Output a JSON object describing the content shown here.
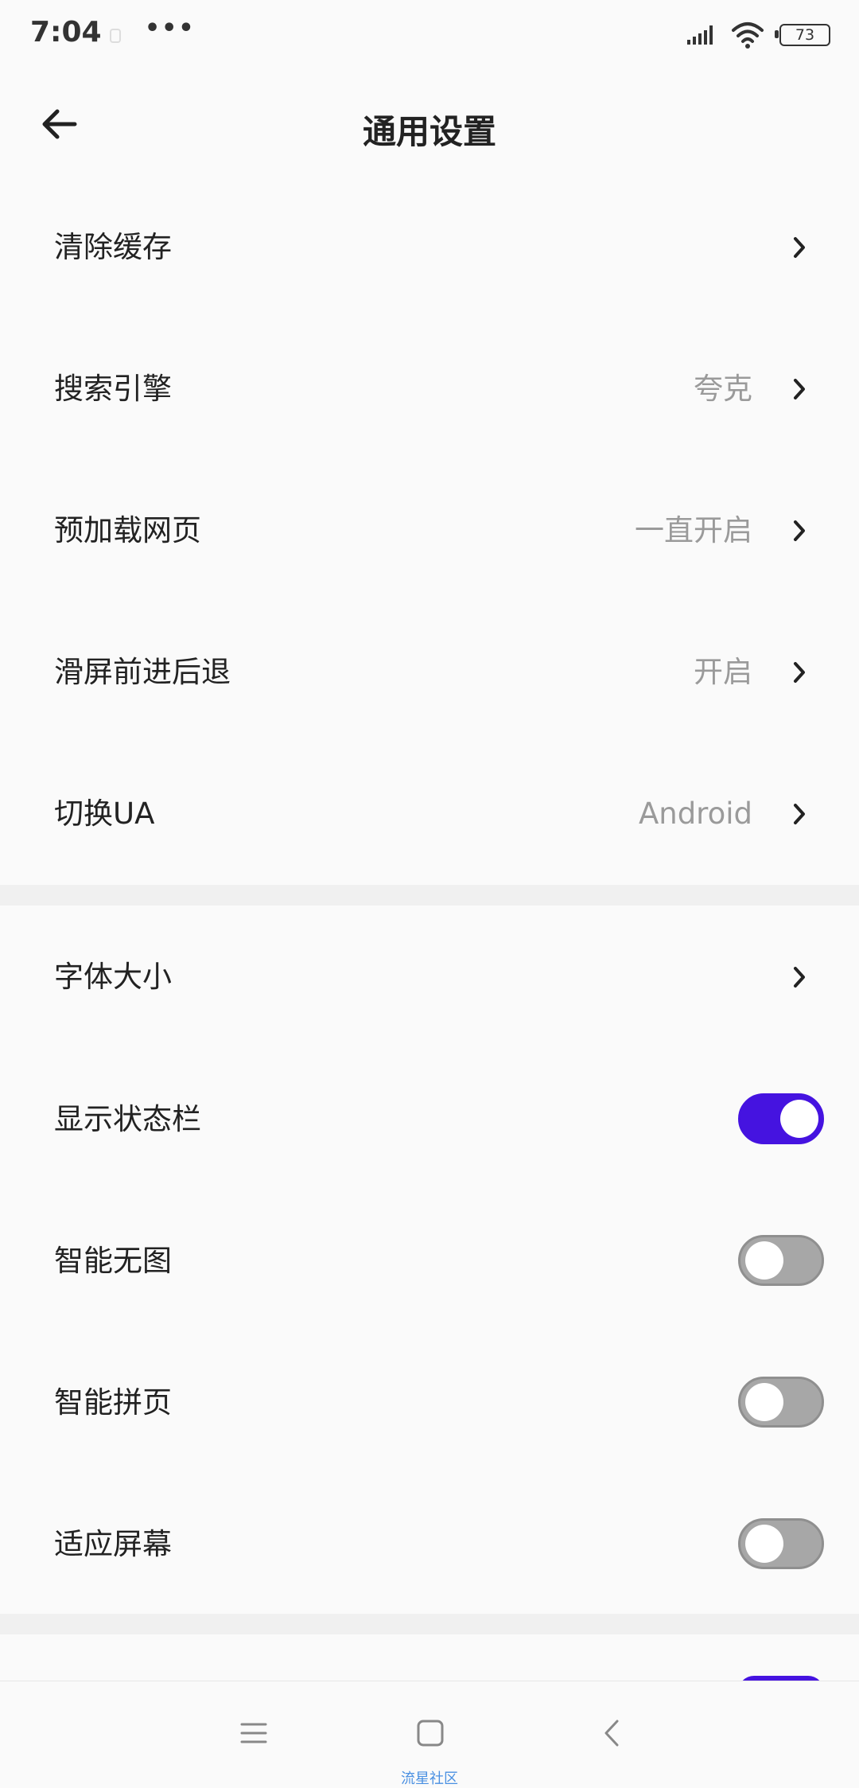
{
  "status_bar": {
    "time": "7:04",
    "battery": "73"
  },
  "header": {
    "title": "通用设置"
  },
  "group1": [
    {
      "label": "清除缓存",
      "value": ""
    },
    {
      "label": "搜索引擎",
      "value": "夸克"
    },
    {
      "label": "预加载网页",
      "value": "一直开启"
    },
    {
      "label": "滑屏前进后退",
      "value": "开启"
    },
    {
      "label": "切换UA",
      "value": "Android"
    }
  ],
  "group2": {
    "font_size": {
      "label": "字体大小"
    },
    "toggles": [
      {
        "label": "显示状态栏",
        "on": true
      },
      {
        "label": "智能无图",
        "on": false
      },
      {
        "label": "智能拼页",
        "on": false
      },
      {
        "label": "适应屏幕",
        "on": false
      }
    ]
  },
  "nav": {
    "watermark": "流星社区"
  },
  "colors": {
    "accent": "#4513e0",
    "toggle_off": "#a7a7a7",
    "value_text": "#9a9a9a"
  }
}
